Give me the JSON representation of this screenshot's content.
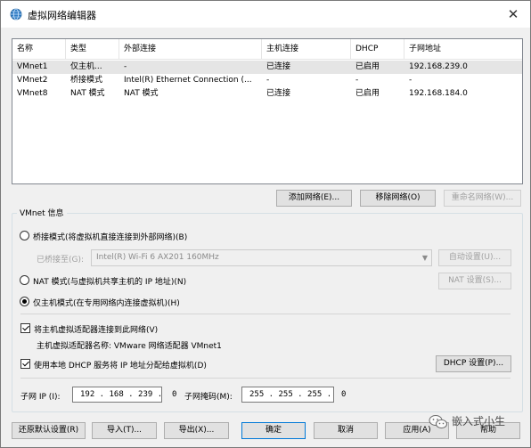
{
  "window": {
    "title": "虚拟网络编辑器",
    "close_glyph": "✕"
  },
  "table": {
    "headers": [
      "名称",
      "类型",
      "外部连接",
      "主机连接",
      "DHCP",
      "子网地址"
    ],
    "rows": [
      [
        "VMnet1",
        "仅主机...",
        "-",
        "已连接",
        "已启用",
        "192.168.239.0"
      ],
      [
        "VMnet2",
        "桥接模式",
        "Intel(R) Ethernet Connection (...",
        "-",
        "-",
        "-"
      ],
      [
        "VMnet8",
        "NAT 模式",
        "NAT 模式",
        "已连接",
        "已启用",
        "192.168.184.0"
      ]
    ],
    "selected_row": 0
  },
  "table_buttons": {
    "add": "添加网络(E)...",
    "remove": "移除网络(O)",
    "rename": "重命名网络(W)..."
  },
  "vmnet_info": {
    "group_label": "VMnet 信息",
    "bridged_label": "桥接模式(将虚拟机直接连接到外部网络)(B)",
    "bridged_to_label": "已桥接至(G):",
    "bridged_to_value": "Intel(R) Wi-Fi 6 AX201 160MHz",
    "auto_settings": "自动设置(U)...",
    "nat_label": "NAT 模式(与虚拟机共享主机的 IP 地址)(N)",
    "nat_settings": "NAT 设置(S)...",
    "hostonly_label": "仅主机模式(在专用网络内连接虚拟机)(H)",
    "selected_mode": "hostonly",
    "connect_adapter_label": "将主机虚拟适配器连接到此网络(V)",
    "connect_adapter_checked": true,
    "adapter_name_label": "主机虚拟适配器名称: VMware 网络适配器 VMnet1",
    "dhcp_label": "使用本地 DHCP 服务将 IP 地址分配给虚拟机(D)",
    "dhcp_checked": true,
    "dhcp_settings": "DHCP 设置(P)...",
    "subnet_ip_label": "子网 IP (I):",
    "subnet_ip_value": "192 . 168 . 239 .  0",
    "subnet_mask_label": "子网掩码(M):",
    "subnet_mask_value": "255 . 255 . 255 .  0"
  },
  "footer_buttons": {
    "restore": "还原默认设置(R)",
    "import": "导入(T)...",
    "export": "导出(X)...",
    "ok": "确定",
    "cancel": "取消",
    "apply": "应用(A)",
    "help": "帮助"
  },
  "watermark": {
    "text": "嵌入式小生"
  },
  "colors": {
    "selected_row": "#e5e5e5",
    "primary_border": "#0078d7",
    "disabled_text": "#a0a0a0"
  }
}
